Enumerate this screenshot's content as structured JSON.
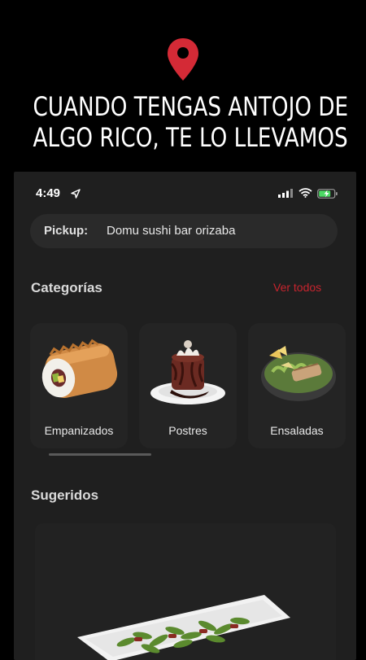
{
  "promo": {
    "line1": "CUANDO TENGAS ANTOJO DE",
    "line2": "ALGO RICO, TE LO LLEVAMOS",
    "pin_icon": "location-pin-icon",
    "pin_color": "#d42a36"
  },
  "status_bar": {
    "time": "4:49"
  },
  "pickup": {
    "label": "Pickup:",
    "value": "Domu sushi bar orizaba"
  },
  "categories": {
    "title": "Categorías",
    "see_all": "Ver todos",
    "items": [
      {
        "label": "Empanizados"
      },
      {
        "label": "Postres"
      },
      {
        "label": "Ensaladas"
      }
    ]
  },
  "suggested": {
    "title": "Sugeridos"
  },
  "colors": {
    "accent": "#c8242e",
    "panel": "#1f1f1f"
  }
}
